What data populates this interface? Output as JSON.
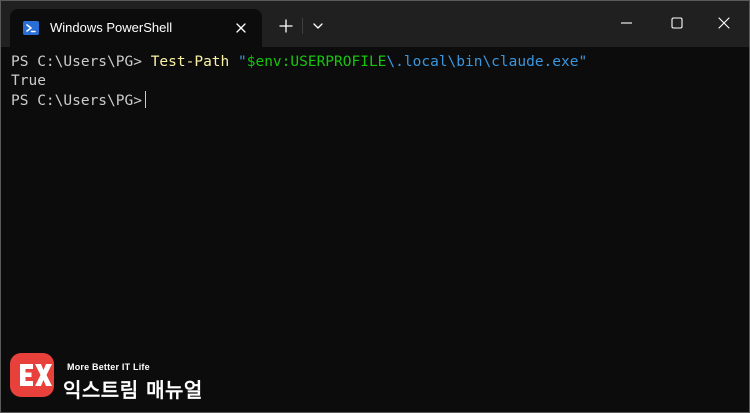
{
  "window": {
    "tab_title": "Windows PowerShell"
  },
  "icons": {
    "tab": "powershell-icon",
    "close_tab": "close-icon",
    "new_tab": "plus-icon",
    "dropdown": "chevron-down-icon",
    "minimize": "minimize-icon",
    "maximize": "maximize-icon",
    "close_window": "close-icon"
  },
  "terminal": {
    "line1": {
      "prompt": "PS C:\\Users\\PG> ",
      "command": "Test-Path",
      "space": " ",
      "quote_open": "\"",
      "variable": "$env:USERPROFILE",
      "path": "\\.local\\bin\\claude.exe",
      "quote_close": "\""
    },
    "line2": "True",
    "line3": {
      "prompt": "PS C:\\Users\\PG>"
    }
  },
  "watermark": {
    "tagline": "More Better IT Life",
    "name": "익스트림 매뉴얼"
  },
  "colors": {
    "titlebar": "#202020",
    "terminal_bg": "#0c0c0c",
    "text": "#cccccc",
    "command": "#f9f1a5",
    "string": "#3a96dd",
    "variable": "#16c60c",
    "logo_red": "#e8413c"
  }
}
